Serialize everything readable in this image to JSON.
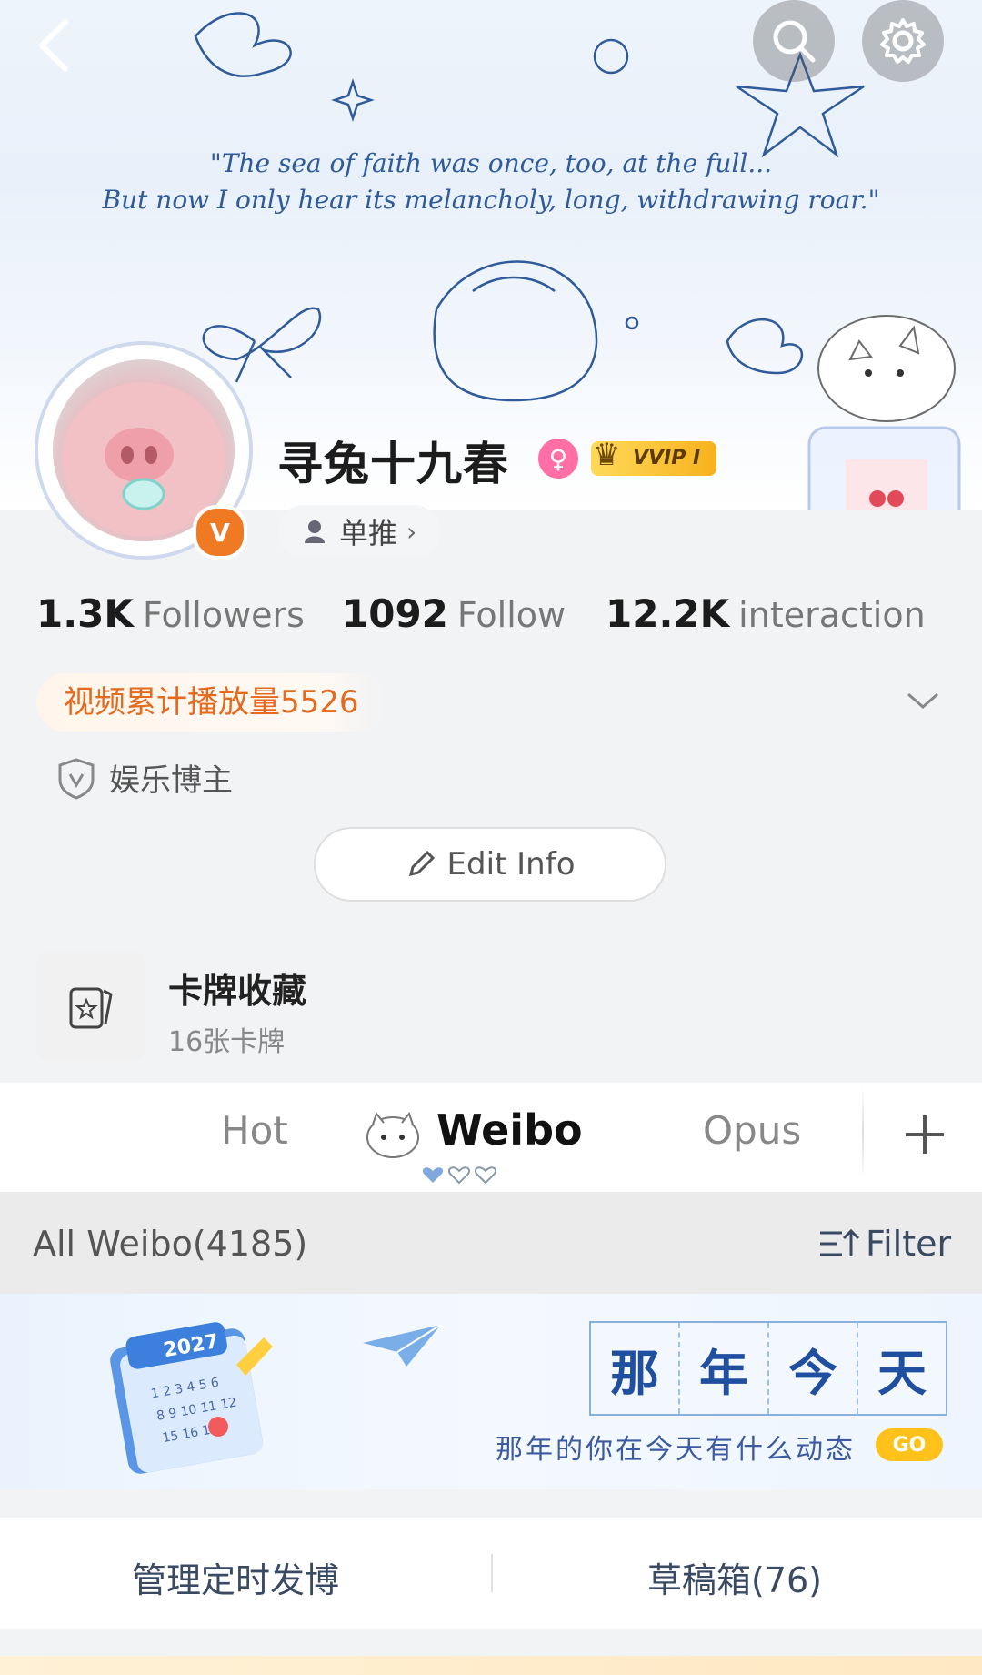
{
  "banner": {
    "quote_line1": "\"The sea of faith was once, too, at the full...",
    "quote_line2": "But now I only hear its melancholy, long, withdrawing roar.\""
  },
  "topbar": {
    "back_icon": "back-chevron-icon",
    "search_icon": "search-icon",
    "settings_icon": "gear-icon"
  },
  "profile": {
    "name": "寻兔十九春",
    "vvip_label": "VVIP I",
    "verified_badge": "V",
    "tag_label": "单推",
    "colors": {
      "accent_orange": "#e56a1d",
      "vip_gold": "#f7b21d",
      "female_pink": "#ff6ea5"
    }
  },
  "stats": [
    {
      "value": "1.3K",
      "label": "Followers"
    },
    {
      "value": "1092",
      "label": "Follow"
    },
    {
      "value": "12.2K",
      "label": "interaction"
    }
  ],
  "video_play": "视频累计播放量5526",
  "certification": "娱乐博主",
  "edit_info": "Edit Info",
  "card_collection": {
    "title": "卡牌收藏",
    "subtitle": "16张卡牌"
  },
  "tabs": [
    {
      "label": "Hot",
      "active": false
    },
    {
      "label": "Weibo",
      "active": true
    },
    {
      "label": "Opus",
      "active": false
    }
  ],
  "filter_bar": {
    "all_label": "All Weibo(4185)",
    "filter_label": "Filter"
  },
  "memory_banner": {
    "title_chars": [
      "那",
      "年",
      "今",
      "天"
    ],
    "subtitle": "那年的你在今天有什么动态",
    "go_label": "GO",
    "calendar_year": "2027"
  },
  "actions": {
    "scheduled": "管理定时发博",
    "drafts": "草稿箱(76)"
  }
}
